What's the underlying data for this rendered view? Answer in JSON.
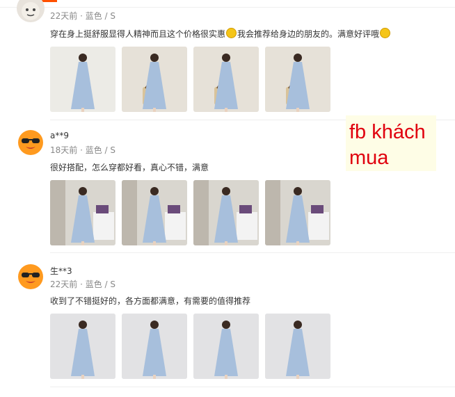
{
  "reviews": [
    {
      "meta": "22天前 · 蓝色 / S",
      "content_a": "穿在身上挺舒服显得人精神而且这个价格很实惠",
      "content_b": "我会推荐给身边的朋友的。满意好评哦",
      "photos": [
        "light",
        "bag",
        "bag",
        "bag"
      ]
    },
    {
      "username": "a**9",
      "meta": "18天前 · 蓝色 / S",
      "content": "很好搭配，怎么穿都好看，真心不错，满意",
      "photos": [
        "room",
        "room",
        "room",
        "room"
      ]
    },
    {
      "username": "生**3",
      "meta": "22天前 · 蓝色 / S",
      "content": "收到了不错挺好的，各方面都满意，有需要的值得推荐",
      "photos": [
        "studio",
        "studio",
        "studio",
        "studio"
      ]
    }
  ],
  "overlay_note": "fb khách mua",
  "colors": {
    "accent": "#ff5000",
    "note_text": "#e0000e",
    "note_bg": "#fefde6",
    "dress": "#a7bfdc"
  }
}
